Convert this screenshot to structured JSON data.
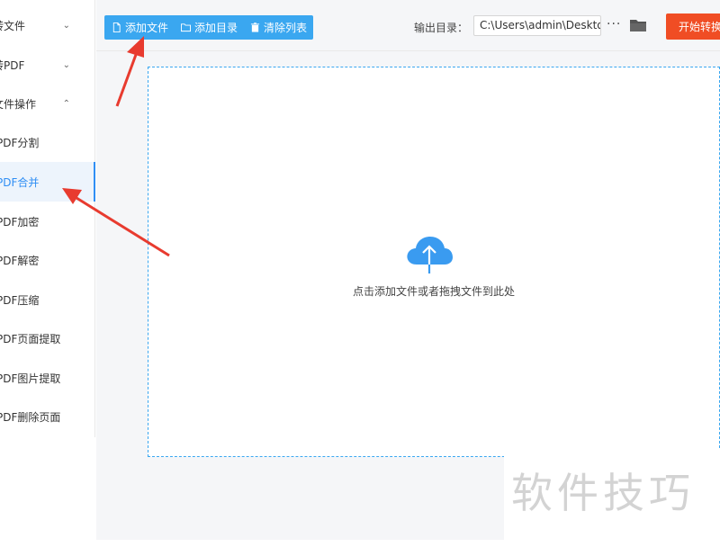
{
  "sidebar": {
    "groups": [
      {
        "label": "转文件",
        "chevron": "chevron-down"
      },
      {
        "label": "转PDF",
        "chevron": "chevron-down"
      },
      {
        "label": "文件操作",
        "chevron": "chevron-up"
      }
    ],
    "items": [
      {
        "label": "PDF分割",
        "active": false
      },
      {
        "label": "PDF合并",
        "active": true
      },
      {
        "label": "PDF加密",
        "active": false
      },
      {
        "label": "PDF解密",
        "active": false
      },
      {
        "label": "PDF压缩",
        "active": false
      },
      {
        "label": "PDF页面提取",
        "active": false
      },
      {
        "label": "PDF图片提取",
        "active": false
      },
      {
        "label": "PDF删除页面",
        "active": false
      }
    ]
  },
  "toolbar": {
    "add_file": "添加文件",
    "add_folder": "添加目录",
    "clear_list": "清除列表"
  },
  "output": {
    "label": "输出目录：",
    "path": "C:\\Users\\admin\\Deskto",
    "more": "···",
    "start_button": "开始转换"
  },
  "dropzone": {
    "hint": "点击添加文件或者拖拽文件到此处",
    "icon": "cloud-upload-icon"
  },
  "watermark": {
    "text": "软件技巧"
  },
  "colors": {
    "accent": "#3aa7f0",
    "start": "#f04d24",
    "arrow": "#e83b2f",
    "active_text": "#2f8ef4"
  }
}
